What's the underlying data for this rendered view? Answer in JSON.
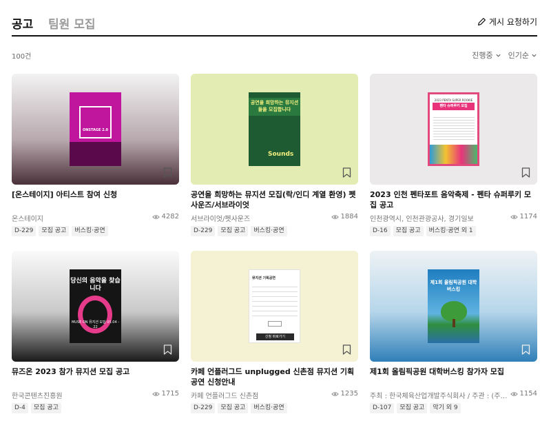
{
  "header": {
    "tabs": [
      {
        "label": "공고",
        "active": true
      },
      {
        "label": "팀원 모집",
        "active": false
      }
    ],
    "write_label": "게시 요청하기"
  },
  "subbar": {
    "count": "100건",
    "filters": [
      {
        "label": "진행중"
      },
      {
        "label": "인기순"
      }
    ]
  },
  "colors": {
    "text": "#111111",
    "muted": "#777777",
    "tag_bg": "#f2f2f2",
    "accent_pink": "#e8337b"
  },
  "cards": [
    {
      "title": "[온스테이지] 아티스트 참여 신청",
      "org": "온스테이지",
      "views": "4282",
      "tags": [
        "D-229",
        "모집 공고",
        "버스킹·공연"
      ],
      "poster": {
        "text": "ONSTAGE 2.0"
      }
    },
    {
      "title": "공연을 희망하는 뮤지션 모집(락/인디 계열 환영) 펫사운즈/서브라이엇",
      "org": "서브라이엇/펫사운즈",
      "views": "1884",
      "tags": [
        "D-229",
        "모집 공고",
        "버스킹·공연"
      ],
      "poster": {
        "text": "공연을 희망하는 뮤지션들을 모집합니다",
        "logo": "Sounds"
      }
    },
    {
      "title": "2023 인천 펜타포트 음악축제 - 펜타 슈퍼루키 모집 공고",
      "org": "인천광역시, 인천관광공사, 경기일보",
      "views": "1174",
      "tags": [
        "D-16",
        "모집 공고",
        "버스킹·공연 외 1"
      ],
      "poster": {
        "header": "2023 PENTA SUPER ROOKIE",
        "text": "펜타 슈퍼루키 모집"
      }
    },
    {
      "title": "뮤즈온 2023 참가 뮤지션 모집 공고",
      "org": "한국콘텐츠진흥원",
      "views": "1715",
      "tags": [
        "D-4",
        "모집 공고"
      ],
      "poster": {
        "text": "당신의 음악을 찾습니다",
        "info": "MUSE ON 뮤지션 모집 05.04 - 22"
      }
    },
    {
      "title": "카페 언플러그드 unplugged 신촌점 뮤지션 기획공연 신청안내",
      "org": "카페 언플러그드 신촌점",
      "views": "1235",
      "tags": [
        "D-229",
        "모집 공고",
        "버스킹·공연"
      ],
      "poster": {
        "text": "뮤지션 기획공연",
        "button": "신청 바로가기"
      }
    },
    {
      "title": "제1회 올림픽공원 대학버스킹 참가자 모집",
      "org": "주최 : 한국체육산업개발주식회사 / 주관 : (주)레...",
      "views": "1154",
      "tags": [
        "D-107",
        "모집 공고",
        "악기 외 9"
      ],
      "poster": {
        "text": "제1회 올림픽공원 대학 버스킹"
      }
    }
  ]
}
